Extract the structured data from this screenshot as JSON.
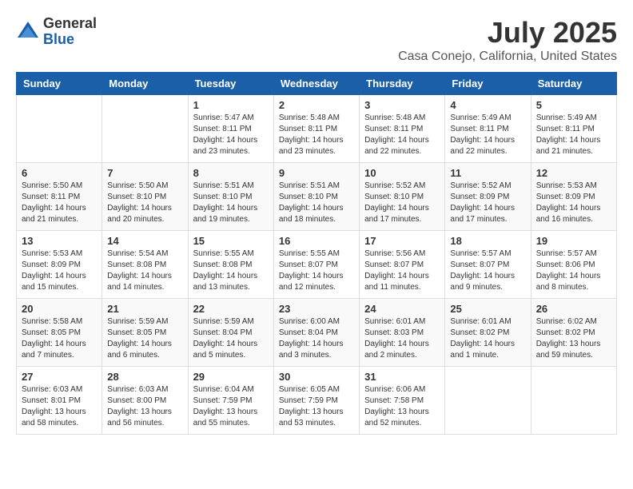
{
  "header": {
    "logo_general": "General",
    "logo_blue": "Blue",
    "title": "July 2025",
    "location": "Casa Conejo, California, United States"
  },
  "weekdays": [
    "Sunday",
    "Monday",
    "Tuesday",
    "Wednesday",
    "Thursday",
    "Friday",
    "Saturday"
  ],
  "weeks": [
    [
      {
        "day": "",
        "info": ""
      },
      {
        "day": "",
        "info": ""
      },
      {
        "day": "1",
        "info": "Sunrise: 5:47 AM\nSunset: 8:11 PM\nDaylight: 14 hours and 23 minutes."
      },
      {
        "day": "2",
        "info": "Sunrise: 5:48 AM\nSunset: 8:11 PM\nDaylight: 14 hours and 23 minutes."
      },
      {
        "day": "3",
        "info": "Sunrise: 5:48 AM\nSunset: 8:11 PM\nDaylight: 14 hours and 22 minutes."
      },
      {
        "day": "4",
        "info": "Sunrise: 5:49 AM\nSunset: 8:11 PM\nDaylight: 14 hours and 22 minutes."
      },
      {
        "day": "5",
        "info": "Sunrise: 5:49 AM\nSunset: 8:11 PM\nDaylight: 14 hours and 21 minutes."
      }
    ],
    [
      {
        "day": "6",
        "info": "Sunrise: 5:50 AM\nSunset: 8:11 PM\nDaylight: 14 hours and 21 minutes."
      },
      {
        "day": "7",
        "info": "Sunrise: 5:50 AM\nSunset: 8:10 PM\nDaylight: 14 hours and 20 minutes."
      },
      {
        "day": "8",
        "info": "Sunrise: 5:51 AM\nSunset: 8:10 PM\nDaylight: 14 hours and 19 minutes."
      },
      {
        "day": "9",
        "info": "Sunrise: 5:51 AM\nSunset: 8:10 PM\nDaylight: 14 hours and 18 minutes."
      },
      {
        "day": "10",
        "info": "Sunrise: 5:52 AM\nSunset: 8:10 PM\nDaylight: 14 hours and 17 minutes."
      },
      {
        "day": "11",
        "info": "Sunrise: 5:52 AM\nSunset: 8:09 PM\nDaylight: 14 hours and 17 minutes."
      },
      {
        "day": "12",
        "info": "Sunrise: 5:53 AM\nSunset: 8:09 PM\nDaylight: 14 hours and 16 minutes."
      }
    ],
    [
      {
        "day": "13",
        "info": "Sunrise: 5:53 AM\nSunset: 8:09 PM\nDaylight: 14 hours and 15 minutes."
      },
      {
        "day": "14",
        "info": "Sunrise: 5:54 AM\nSunset: 8:08 PM\nDaylight: 14 hours and 14 minutes."
      },
      {
        "day": "15",
        "info": "Sunrise: 5:55 AM\nSunset: 8:08 PM\nDaylight: 14 hours and 13 minutes."
      },
      {
        "day": "16",
        "info": "Sunrise: 5:55 AM\nSunset: 8:07 PM\nDaylight: 14 hours and 12 minutes."
      },
      {
        "day": "17",
        "info": "Sunrise: 5:56 AM\nSunset: 8:07 PM\nDaylight: 14 hours and 11 minutes."
      },
      {
        "day": "18",
        "info": "Sunrise: 5:57 AM\nSunset: 8:07 PM\nDaylight: 14 hours and 9 minutes."
      },
      {
        "day": "19",
        "info": "Sunrise: 5:57 AM\nSunset: 8:06 PM\nDaylight: 14 hours and 8 minutes."
      }
    ],
    [
      {
        "day": "20",
        "info": "Sunrise: 5:58 AM\nSunset: 8:05 PM\nDaylight: 14 hours and 7 minutes."
      },
      {
        "day": "21",
        "info": "Sunrise: 5:59 AM\nSunset: 8:05 PM\nDaylight: 14 hours and 6 minutes."
      },
      {
        "day": "22",
        "info": "Sunrise: 5:59 AM\nSunset: 8:04 PM\nDaylight: 14 hours and 5 minutes."
      },
      {
        "day": "23",
        "info": "Sunrise: 6:00 AM\nSunset: 8:04 PM\nDaylight: 14 hours and 3 minutes."
      },
      {
        "day": "24",
        "info": "Sunrise: 6:01 AM\nSunset: 8:03 PM\nDaylight: 14 hours and 2 minutes."
      },
      {
        "day": "25",
        "info": "Sunrise: 6:01 AM\nSunset: 8:02 PM\nDaylight: 14 hours and 1 minute."
      },
      {
        "day": "26",
        "info": "Sunrise: 6:02 AM\nSunset: 8:02 PM\nDaylight: 13 hours and 59 minutes."
      }
    ],
    [
      {
        "day": "27",
        "info": "Sunrise: 6:03 AM\nSunset: 8:01 PM\nDaylight: 13 hours and 58 minutes."
      },
      {
        "day": "28",
        "info": "Sunrise: 6:03 AM\nSunset: 8:00 PM\nDaylight: 13 hours and 56 minutes."
      },
      {
        "day": "29",
        "info": "Sunrise: 6:04 AM\nSunset: 7:59 PM\nDaylight: 13 hours and 55 minutes."
      },
      {
        "day": "30",
        "info": "Sunrise: 6:05 AM\nSunset: 7:59 PM\nDaylight: 13 hours and 53 minutes."
      },
      {
        "day": "31",
        "info": "Sunrise: 6:06 AM\nSunset: 7:58 PM\nDaylight: 13 hours and 52 minutes."
      },
      {
        "day": "",
        "info": ""
      },
      {
        "day": "",
        "info": ""
      }
    ]
  ]
}
